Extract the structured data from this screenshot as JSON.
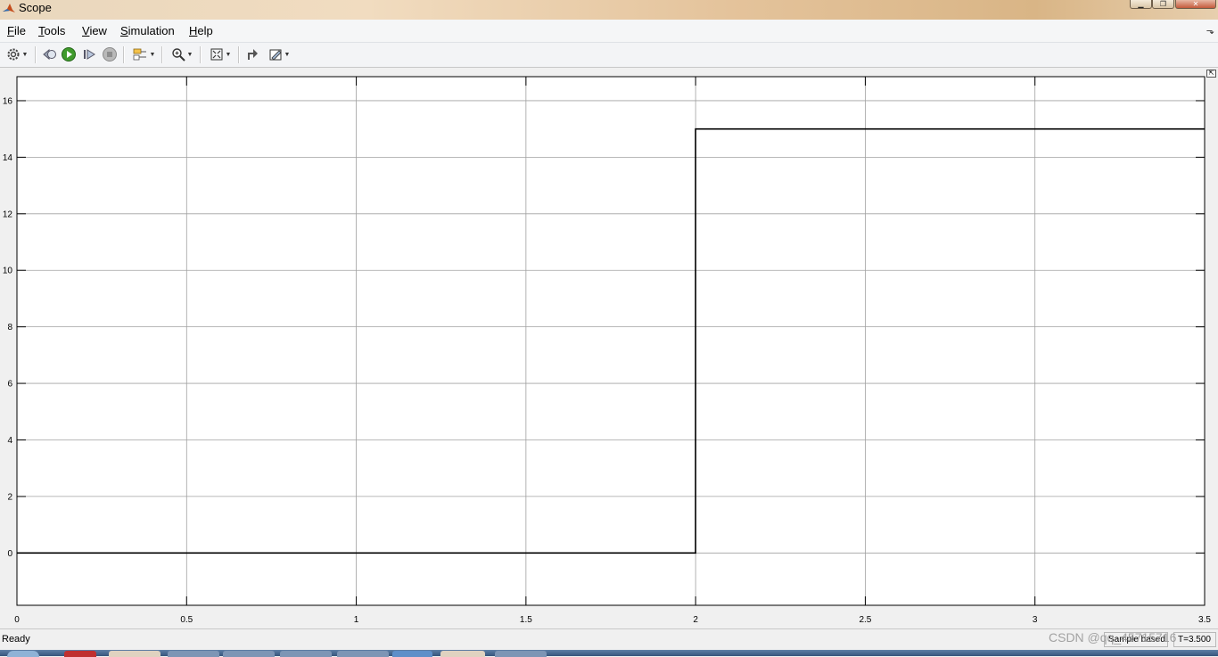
{
  "window": {
    "title": "Scope",
    "controls": [
      "minimize-icon",
      "restore-icon",
      "close-icon"
    ]
  },
  "menu": {
    "items": [
      {
        "label": "File",
        "mnemonic": "F",
        "rest": "ile"
      },
      {
        "label": "Tools",
        "mnemonic": "T",
        "rest": "ools"
      },
      {
        "label": "View",
        "mnemonic": "V",
        "rest": "iew"
      },
      {
        "label": "Simulation",
        "mnemonic": "S",
        "rest": "imulation"
      },
      {
        "label": "Help",
        "mnemonic": "H",
        "rest": "elp"
      }
    ]
  },
  "toolbar": {
    "icons": [
      "settings-gear-icon",
      "step-back-icon",
      "run-icon",
      "step-forward-icon",
      "stop-icon",
      "signal-select-icon",
      "zoom-in-icon",
      "fit-to-view-icon",
      "highlight-block-icon",
      "style-edit-icon"
    ]
  },
  "status": {
    "ready": "Ready",
    "sample_based": "Sample based",
    "time": "T=3.500"
  },
  "watermark": "CSDN @qq_45715716",
  "chart_data": {
    "type": "line",
    "title": "",
    "xlabel": "",
    "ylabel": "",
    "xlim": [
      0,
      3.5
    ],
    "ylim": [
      -1.85,
      16.85
    ],
    "xticks": [
      0,
      0.5,
      1,
      1.5,
      2,
      2.5,
      3,
      3.5
    ],
    "xtick_labels": [
      "0",
      "0.5",
      "1",
      "1.5",
      "2",
      "2.5",
      "3",
      "3.5"
    ],
    "yticks": [
      0,
      2,
      4,
      6,
      8,
      10,
      12,
      14,
      16
    ],
    "ytick_labels": [
      "0",
      "2",
      "4",
      "6",
      "8",
      "10",
      "12",
      "14",
      "16"
    ],
    "grid": true,
    "series": [
      {
        "style": "step",
        "color": "#000000",
        "x": [
          0,
          2,
          2,
          3.5
        ],
        "y": [
          0,
          0,
          15,
          15
        ]
      }
    ]
  }
}
